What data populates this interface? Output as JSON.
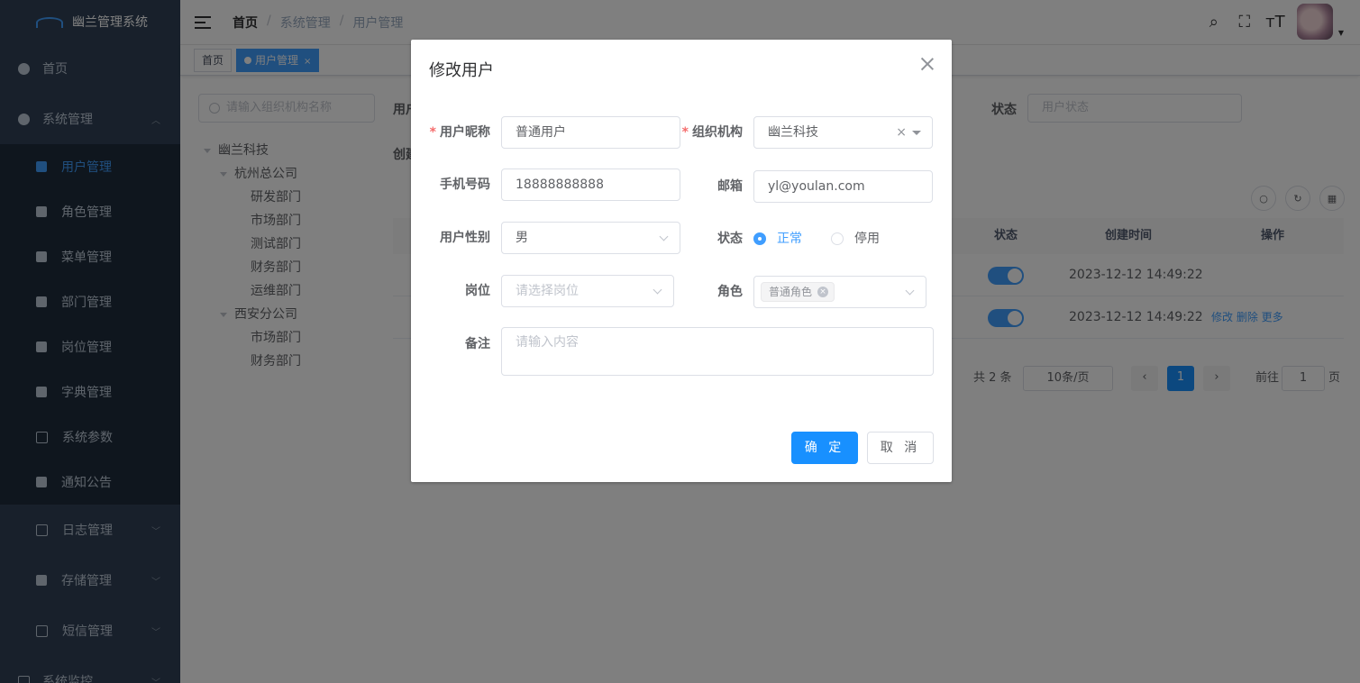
{
  "sidebar": {
    "logo_text": "幽兰管理系统",
    "home": "首页",
    "system": "系统管理",
    "sub_items": [
      "用户管理",
      "角色管理",
      "菜单管理",
      "部门管理",
      "岗位管理",
      "字典管理",
      "系统参数",
      "通知公告"
    ],
    "more_items": [
      "日志管理",
      "存储管理",
      "短信管理",
      "系统监控"
    ]
  },
  "header": {
    "breadcrumb": [
      "首页",
      "系统管理",
      "用户管理"
    ],
    "tags": [
      "首页",
      "用户管理"
    ]
  },
  "page": {
    "tree_search_placeholder": "请输入组织机构名称",
    "tree": [
      {
        "label": "幽兰科技",
        "level": 0,
        "caret": true
      },
      {
        "label": "杭州总公司",
        "level": 1,
        "caret": true
      },
      {
        "label": "研发部门",
        "level": 2,
        "caret": false
      },
      {
        "label": "市场部门",
        "level": 2,
        "caret": false
      },
      {
        "label": "测试部门",
        "level": 2,
        "caret": false
      },
      {
        "label": "财务部门",
        "level": 2,
        "caret": false
      },
      {
        "label": "运维部门",
        "level": 2,
        "caret": false
      },
      {
        "label": "西安分公司",
        "level": 1,
        "caret": true
      },
      {
        "label": "市场部门",
        "level": 2,
        "caret": false
      },
      {
        "label": "财务部门",
        "level": 2,
        "caret": false
      }
    ],
    "filter_label_user": "用户",
    "filter_label_created": "创建",
    "filter_label_status": "状态",
    "filter_status_placeholder": "用户状态",
    "table_headers": {
      "status": "状态",
      "created": "创建时间",
      "ops": "操作"
    },
    "rows": [
      {
        "created": "2023-12-12 14:49:22",
        "ops": ""
      },
      {
        "created": "2023-12-12 14:49:22",
        "ops": "修改  删除  更多"
      }
    ],
    "pager": {
      "total": "共 2 条",
      "size": "10条/页",
      "current": "1",
      "goto": "前往",
      "goto_value": "1",
      "page_unit": "页"
    }
  },
  "dialog": {
    "title": "修改用户",
    "nickname_label": "用户昵称",
    "nickname_value": "普通用户",
    "org_label": "组织机构",
    "org_value": "幽兰科技",
    "phone_label": "手机号码",
    "phone_value": "18888888888",
    "email_label": "邮箱",
    "email_value": "yl@youlan.com",
    "gender_label": "用户性别",
    "gender_value": "男",
    "status_label": "状态",
    "status_normal": "正常",
    "status_disabled": "停用",
    "post_label": "岗位",
    "post_placeholder": "请选择岗位",
    "role_label": "角色",
    "role_chip": "普通角色",
    "remark_label": "备注",
    "remark_placeholder": "请输入内容",
    "confirm": "确 定",
    "cancel": "取 消"
  },
  "colors": {
    "primary": "#1890ff",
    "sidebar": "#304156",
    "submenu": "#1f2d3d"
  }
}
